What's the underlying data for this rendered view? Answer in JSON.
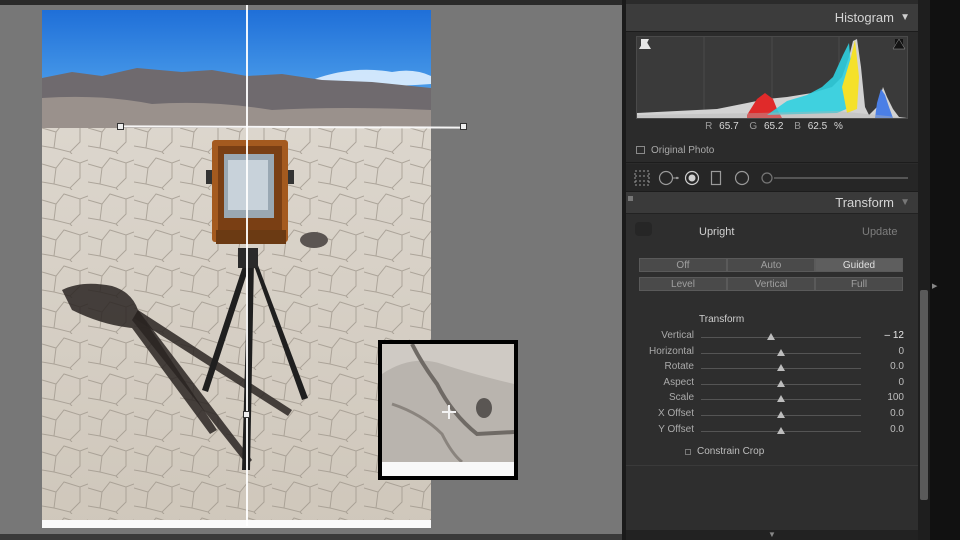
{
  "histogram": {
    "title": "Histogram",
    "readout": {
      "r_label": "R",
      "r_value": "65.7",
      "g_label": "G",
      "g_value": "65.2",
      "b_label": "B",
      "b_value": "62.5",
      "unit": "%"
    },
    "original_photo_label": "Original Photo"
  },
  "transform": {
    "title": "Transform",
    "upright_label": "Upright",
    "update_label": "Update",
    "upright_modes_row1": [
      {
        "label": "Off",
        "active": false
      },
      {
        "label": "Auto",
        "active": false
      },
      {
        "label": "Guided",
        "active": true
      }
    ],
    "upright_modes_row2": [
      {
        "label": "Level",
        "active": false
      },
      {
        "label": "Vertical",
        "active": false
      },
      {
        "label": "Full",
        "active": false
      }
    ],
    "section_title": "Transform",
    "sliders": [
      {
        "label": "Vertical",
        "value": "– 12",
        "position": 0.44
      },
      {
        "label": "Horizontal",
        "value": "0",
        "position": 0.5
      },
      {
        "label": "Rotate",
        "value": "0.0",
        "position": 0.5
      },
      {
        "label": "Aspect",
        "value": "0",
        "position": 0.5
      },
      {
        "label": "Scale",
        "value": "100",
        "position": 0.5
      },
      {
        "label": "X Offset",
        "value": "0.0",
        "position": 0.5
      },
      {
        "label": "Y Offset",
        "value": "0.0",
        "position": 0.5
      }
    ],
    "constrain_crop_label": "Constrain Crop"
  },
  "colors": {
    "accent": "#e0e0e0",
    "panel_bg": "#2e2e2e",
    "canvas_bg": "#777777"
  }
}
